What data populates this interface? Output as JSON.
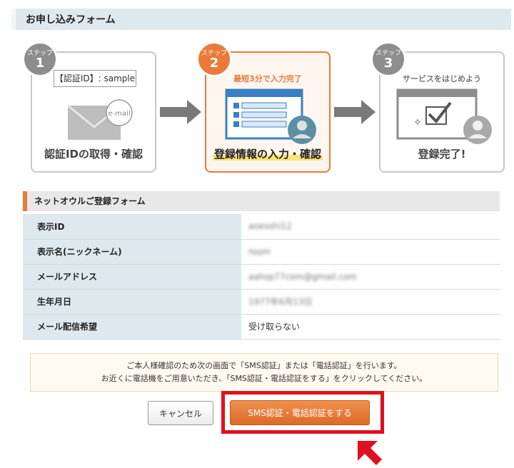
{
  "header": {
    "title": "お申し込みフォーム"
  },
  "steps": [
    {
      "label": "ステップ",
      "number": "1",
      "auth_box": "【認証ID】: sample",
      "envelope_text": "e-mail",
      "caption": "認証IDの取得・確認"
    },
    {
      "label": "ステップ",
      "number": "2",
      "tag": "最短3分で入力完了",
      "caption": "登録情報の入力・確認"
    },
    {
      "label": "ステップ",
      "number": "3",
      "tag": "サービスをはじめよう",
      "caption": "登録完了!"
    }
  ],
  "section": {
    "title": "ネットオウルご登録フォーム"
  },
  "fields": [
    {
      "label": "表示ID",
      "value": "aoesshi12"
    },
    {
      "label": "表示名(ニックネーム)",
      "value": "room"
    },
    {
      "label": "メールアドレス",
      "value": "aahsp77com@gmail.com"
    },
    {
      "label": "生年月日",
      "value": "1977年6月13日"
    },
    {
      "label": "メール配信希望",
      "value": "受け取らない"
    }
  ],
  "notice": {
    "line1": "ご本人様確認のため次の画面で「SMS認証」または「電話認証」を行います。",
    "line2": "お近くに電話機をご用意いただき、「SMS認証・電話認証をする」をクリックしてください。"
  },
  "buttons": {
    "cancel": "キャンセル",
    "submit": "SMS認証・電話認証をする"
  },
  "colors": {
    "accent": "#e97a3a",
    "highlight": "#e0101e",
    "table_label_bg": "#dde9ee"
  }
}
